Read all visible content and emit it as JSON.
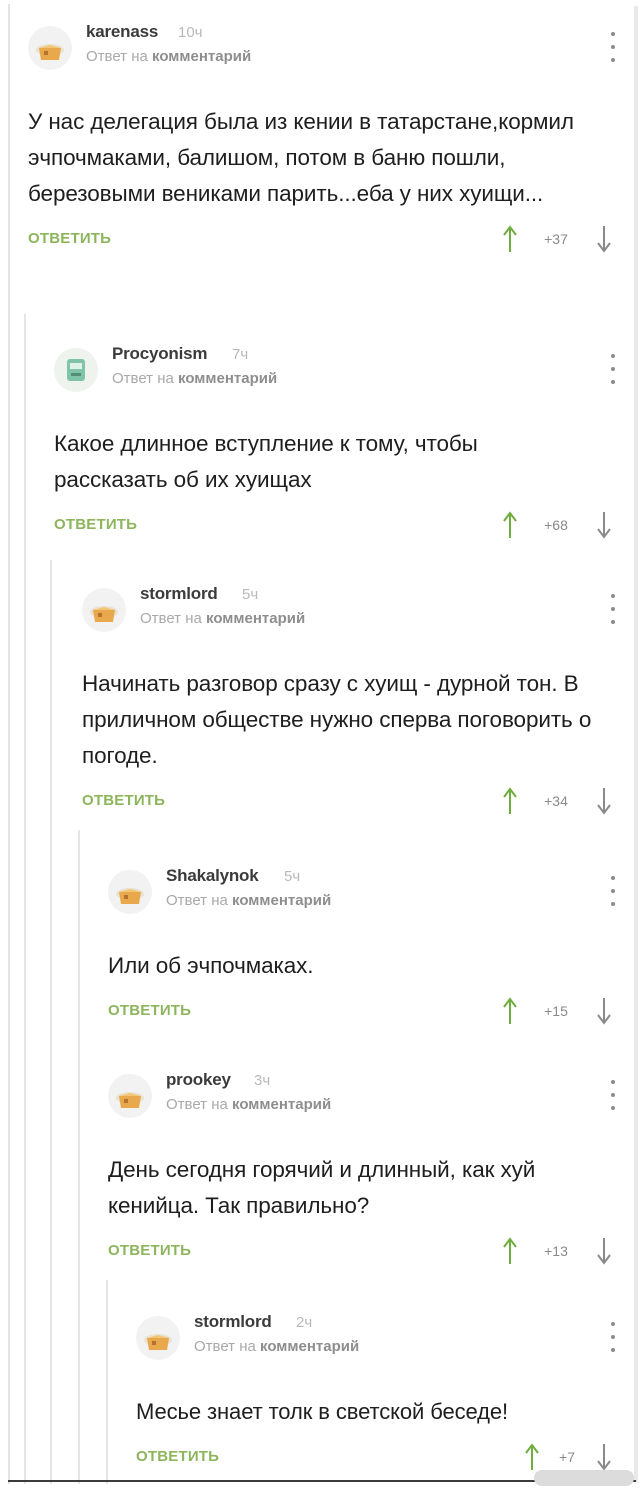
{
  "comments": [
    {
      "author": "karenass",
      "time": "10ч",
      "reply_prefix": "Ответ на",
      "reply_target": "комментарий",
      "text": "У нас делегация была из кении в татарстане,кормил эчпочмаками, балишом, потом в баню пошли, березовыми вениками парить...еба у них хуищи...",
      "reply_label": "ОТВЕТИТЬ",
      "score": "+37",
      "avatar": "cat-in-box-avatar"
    },
    {
      "author": "Procyonism",
      "time": "7ч",
      "reply_prefix": "Ответ на",
      "reply_target": "комментарий",
      "text": "Какое длинное вступление к тому, чтобы рассказать об их хуищах",
      "reply_label": "ОТВЕТИТЬ",
      "score": "+68",
      "avatar": "robot-avatar"
    },
    {
      "author": "stormlord",
      "time": "5ч",
      "reply_prefix": "Ответ на",
      "reply_target": "комментарий",
      "text": "Начинать разговор сразу с хуищ - дурной тон. В приличном обществе нужно сперва поговорить о погоде.",
      "reply_label": "ОТВЕТИТЬ",
      "score": "+34",
      "avatar": "cat-in-box-avatar"
    },
    {
      "author": "Shakalynok",
      "time": "5ч",
      "reply_prefix": "Ответ на",
      "reply_target": "комментарий",
      "text": "Или об эчпочмаках.",
      "reply_label": "ОТВЕТИТЬ",
      "score": "+15",
      "avatar": "cat-in-box-avatar"
    },
    {
      "author": "prookey",
      "time": "3ч",
      "reply_prefix": "Ответ на",
      "reply_target": "комментарий",
      "text": "День сегодня горячий и длинный, как хуй кенийца. Так правильно?",
      "reply_label": "ОТВЕТИТЬ",
      "score": "+13",
      "avatar": "cat-in-box-avatar"
    },
    {
      "author": "stormlord",
      "time": "2ч",
      "reply_prefix": "Ответ на",
      "reply_target": "комментарий",
      "text": "Месье знает толк в светской беседе!",
      "reply_label": "ОТВЕТИТЬ",
      "score": "+7",
      "avatar": "cat-in-box-avatar"
    }
  ],
  "icons": {
    "upvote": "arrow-up-icon",
    "downvote": "arrow-down-icon",
    "menu": "more-vertical-icon"
  },
  "colors": {
    "reply_green": "#8db55c",
    "vote_green": "#6fae3e",
    "muted_text": "#a9a9a9"
  }
}
